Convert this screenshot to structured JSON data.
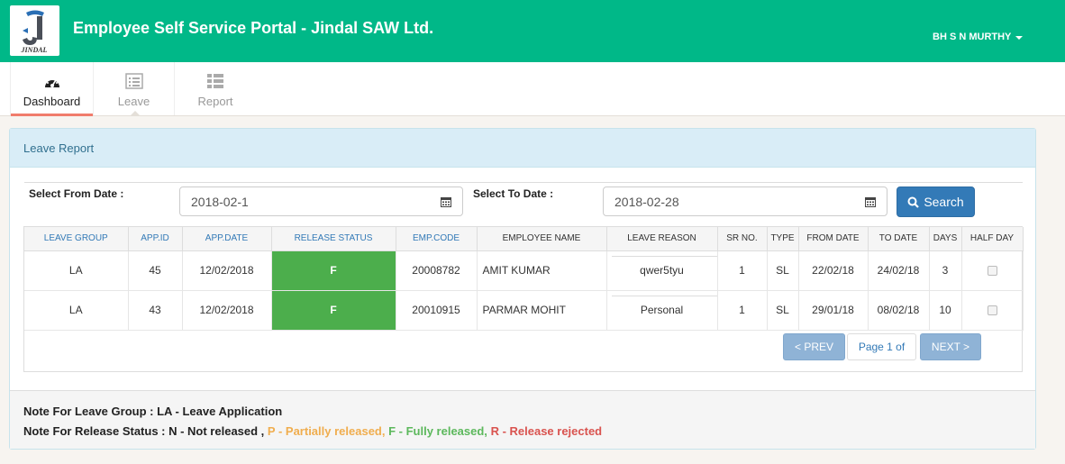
{
  "header": {
    "logo_text": "JINDAL",
    "title": "Employee Self Service Portal - Jindal SAW Ltd.",
    "user_name": "BH S N MURTHY"
  },
  "tabs": [
    {
      "label": "Dashboard",
      "icon": "dashboard-icon",
      "active": true
    },
    {
      "label": "Leave",
      "icon": "list-icon",
      "active": false
    },
    {
      "label": "Report",
      "icon": "list-alt-icon",
      "active": false
    }
  ],
  "panel": {
    "title": "Leave Report",
    "from_label": "Select From Date :",
    "from_value": "2018-02-1",
    "to_label": "Select To Date :",
    "to_value": "2018-02-28",
    "search_label": "Search"
  },
  "table": {
    "headers": [
      "LEAVE GROUP",
      "APP.ID",
      "APP.DATE",
      "RELEASE STATUS",
      "EMP.CODE",
      "EMPLOYEE NAME",
      "LEAVE REASON",
      "SR NO.",
      "TYPE",
      "FROM DATE",
      "TO DATE",
      "DAYS",
      "HALF DAY"
    ],
    "rows": [
      {
        "leave_group": "LA",
        "app_id": "45",
        "app_date": "12/02/2018",
        "release_status": "F",
        "emp_code": "20008782",
        "employee_name": "AMIT KUMAR",
        "leave_reason": "qwer5tyu",
        "sr_no": "1",
        "type": "SL",
        "from_date": "22/02/18",
        "to_date": "24/02/18",
        "days": "3",
        "half_day": false
      },
      {
        "leave_group": "LA",
        "app_id": "43",
        "app_date": "12/02/2018",
        "release_status": "F",
        "emp_code": "20010915",
        "employee_name": "PARMAR MOHIT",
        "leave_reason": "Personal",
        "sr_no": "1",
        "type": "SL",
        "from_date": "29/01/18",
        "to_date": "08/02/18",
        "days": "10",
        "half_day": false
      }
    ]
  },
  "pager": {
    "prev": "< PREV",
    "page": "Page 1 of",
    "next": "NEXT >"
  },
  "notes": {
    "group_note": "Note For Leave Group : LA - Leave Application",
    "status_prefix": "Note For Release Status : N - Not released ,",
    "status_p": "P - Partially released,",
    "status_f": "F - Fully released,",
    "status_r": "R - Release rejected"
  },
  "colors": {
    "header_bg": "#00b888",
    "status_fill": "#4cae4c",
    "primary": "#337ab7",
    "partial": "#f0ad4e",
    "full": "#5cb85c",
    "rejected": "#d9534f"
  }
}
